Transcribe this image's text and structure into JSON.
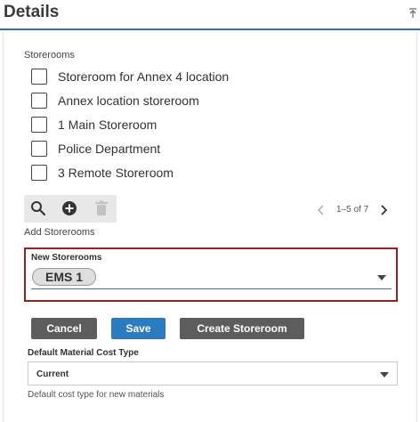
{
  "header": {
    "title": "Details",
    "collapse_icon": "collapse-up-icon"
  },
  "storerooms": {
    "label": "Storerooms",
    "items": [
      {
        "label": "Storeroom for Annex 4 location",
        "checked": false
      },
      {
        "label": "Annex location storeroom",
        "checked": false
      },
      {
        "label": "1 Main Storeroom",
        "checked": false
      },
      {
        "label": "Police Department",
        "checked": false
      },
      {
        "label": "3 Remote Storeroom",
        "checked": false
      }
    ],
    "toolbar": {
      "search_icon": "search-icon",
      "add_icon": "add-circle-icon",
      "delete_icon": "trash-icon"
    },
    "pager": {
      "text": "1–5 of 7"
    }
  },
  "add_storerooms": {
    "label": "Add Storerooms",
    "field_label": "New Storerooms",
    "selected": [
      "EMS 1"
    ]
  },
  "buttons": {
    "cancel": "Cancel",
    "save": "Save",
    "create": "Create Storeroom"
  },
  "cost_type": {
    "label": "Default Material Cost Type",
    "value": "Current",
    "hint": "Default cost type for new materials"
  },
  "colors": {
    "accent": "#2a7bbf",
    "error_border": "#a01e22",
    "underline": "#3a6ea5"
  }
}
